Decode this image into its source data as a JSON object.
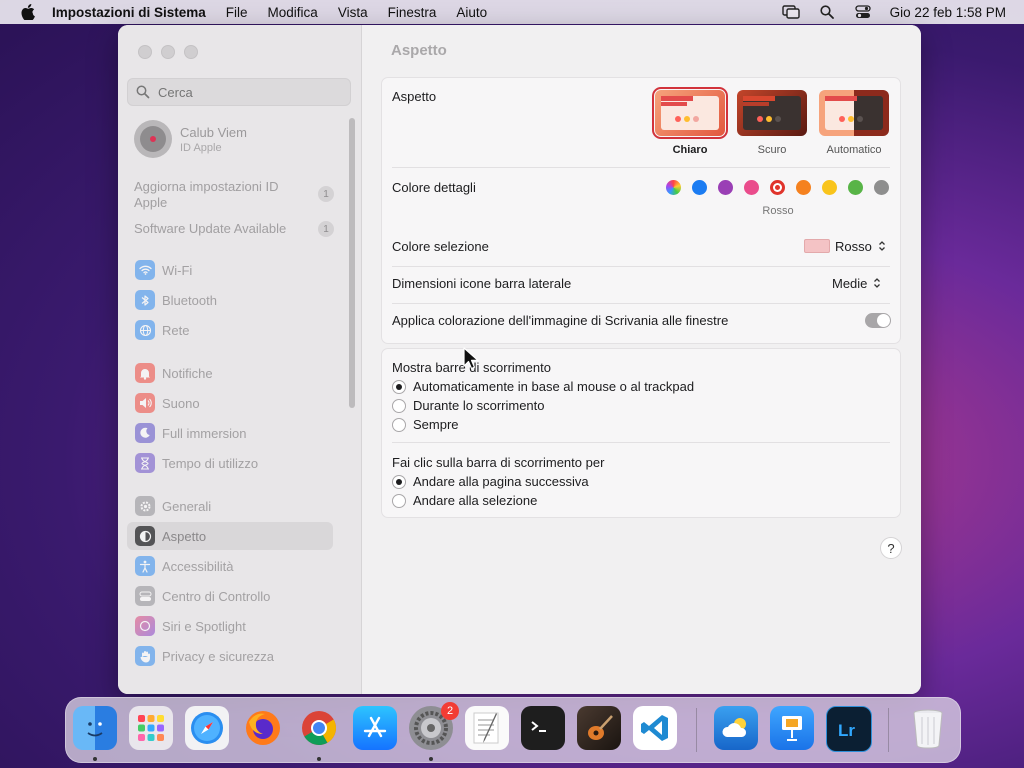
{
  "menubar": {
    "app_name": "Impostazioni di Sistema",
    "items": [
      "File",
      "Modifica",
      "Vista",
      "Finestra",
      "Aiuto"
    ],
    "clock": "Gio 22 feb  1:58 PM"
  },
  "sidebar": {
    "search_placeholder": "Cerca",
    "account": {
      "name": "Calub Viem",
      "subtitle": "ID Apple"
    },
    "notifications": [
      {
        "label": "Aggiorna impostazioni ID Apple",
        "badge": "1"
      },
      {
        "label": "Software Update Available",
        "badge": "1"
      }
    ],
    "items": [
      {
        "label": "Wi-Fi",
        "icon": "wifi-icon",
        "color": "#2f8cf0"
      },
      {
        "label": "Bluetooth",
        "icon": "bluetooth-icon",
        "color": "#2f8cf0"
      },
      {
        "label": "Rete",
        "icon": "globe-icon",
        "color": "#2f8cf0"
      },
      {
        "label": "Notifiche",
        "icon": "bell-icon",
        "color": "#f0453a"
      },
      {
        "label": "Suono",
        "icon": "speaker-icon",
        "color": "#f0453a"
      },
      {
        "label": "Full immersion",
        "icon": "moon-icon",
        "color": "#5b4ec9"
      },
      {
        "label": "Tempo di utilizzo",
        "icon": "hourglass-icon",
        "color": "#6a4fc8"
      },
      {
        "label": "Generali",
        "icon": "gear-icon",
        "color": "#8e8e93"
      },
      {
        "label": "Aspetto",
        "icon": "appearance-icon",
        "color": "#1d1d1f"
      },
      {
        "label": "Accessibilità",
        "icon": "accessibility-icon",
        "color": "#2f8cf0"
      },
      {
        "label": "Centro di Controllo",
        "icon": "control-center-icon",
        "color": "#8e8e93"
      },
      {
        "label": "Siri e Spotlight",
        "icon": "siri-icon",
        "color": "#c03ac2"
      },
      {
        "label": "Privacy e sicurezza",
        "icon": "hand-icon",
        "color": "#2f8cf0"
      }
    ]
  },
  "main": {
    "title": "Aspetto",
    "appearance": {
      "label": "Aspetto",
      "options": [
        "Chiaro",
        "Scuro",
        "Automatico"
      ],
      "selected": "Chiaro"
    },
    "accent": {
      "label": "Colore dettagli",
      "colors": [
        "#a66cd8",
        "#1b7cf2",
        "#9a3fb5",
        "#ea4c8c",
        "#e0342c",
        "#f5811f",
        "#f9c41b",
        "#58b447",
        "#8e8e8e"
      ],
      "selected_name": "Rosso"
    },
    "highlight": {
      "label": "Colore selezione",
      "value": "Rosso",
      "swatch": "#f4c3c5"
    },
    "sidebar_icon_size": {
      "label": "Dimensioni icone barra laterale",
      "value": "Medie"
    },
    "wallpaper_tinting": {
      "label": "Applica colorazione dell'immagine di Scrivania alle finestre"
    },
    "scrollbars": {
      "label": "Mostra barre di scorrimento",
      "options": [
        "Automaticamente in base al mouse o al trackpad",
        "Durante lo scorrimento",
        "Sempre"
      ],
      "selected_index": 0
    },
    "click_scroll": {
      "label": "Fai clic sulla barra di scorrimento per",
      "options": [
        "Andare alla pagina successiva",
        "Andare alla selezione"
      ],
      "selected_index": 0
    },
    "help": "?"
  },
  "dock": {
    "apps": [
      "Finder",
      "Launchpad",
      "Safari",
      "Firefox",
      "Chrome",
      "App Store",
      "Impostazioni di Sistema",
      "TextEdit",
      "Terminale",
      "GarageBand",
      "Visual Studio Code",
      "Meteo",
      "Keynote",
      "Lightroom",
      "Cestino"
    ],
    "settings_badge": "2"
  }
}
